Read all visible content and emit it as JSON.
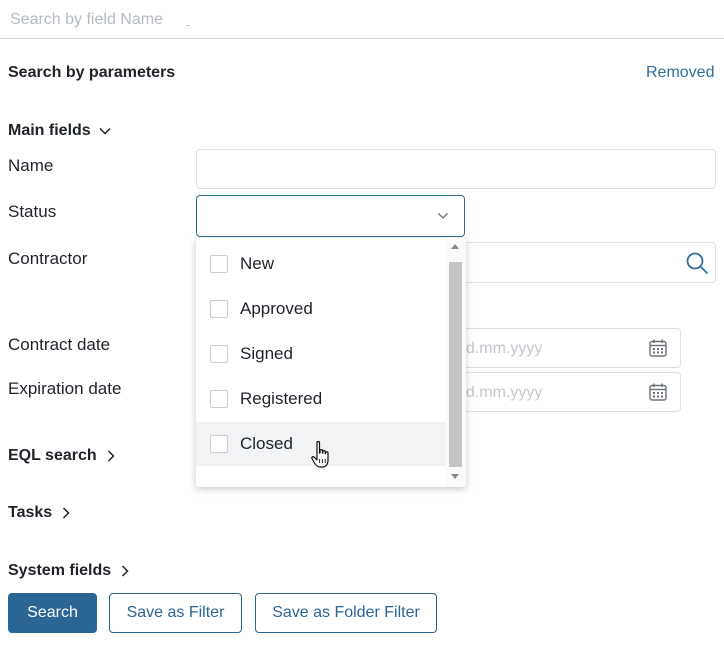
{
  "top_search": {
    "placeholder": "Search by field Name"
  },
  "header": {
    "title": "Search by parameters",
    "removed_link": "Removed"
  },
  "main_fields": {
    "toggle_label": "Main fields"
  },
  "fields": {
    "name_label": "Name",
    "status_label": "Status",
    "contractor_label": "Contractor",
    "contract_date_label": "Contract date",
    "expiration_date_label": "Expiration date",
    "date_placeholder": "dd.mm.yyyy"
  },
  "status_dropdown": {
    "options": [
      {
        "label": "New",
        "checked": false
      },
      {
        "label": "Approved",
        "checked": false
      },
      {
        "label": "Signed",
        "checked": false
      },
      {
        "label": "Registered",
        "checked": false
      },
      {
        "label": "Closed",
        "checked": false
      }
    ]
  },
  "groups": {
    "eql_search": "EQL search",
    "tasks": "Tasks",
    "system_fields": "System fields"
  },
  "buttons": {
    "search": "Search",
    "save_filter": "Save as Filter",
    "save_folder_filter": "Save as Folder Filter"
  },
  "colors": {
    "accent": "#2a6594",
    "link": "#2f6f9c",
    "border": "#dde1e5",
    "hover_row": "#f2f3f4"
  },
  "icons": {
    "chevron": "chevron-down-icon",
    "search": "search-icon",
    "calendar": "calendar-icon",
    "cursor": "hand-pointer-icon"
  }
}
